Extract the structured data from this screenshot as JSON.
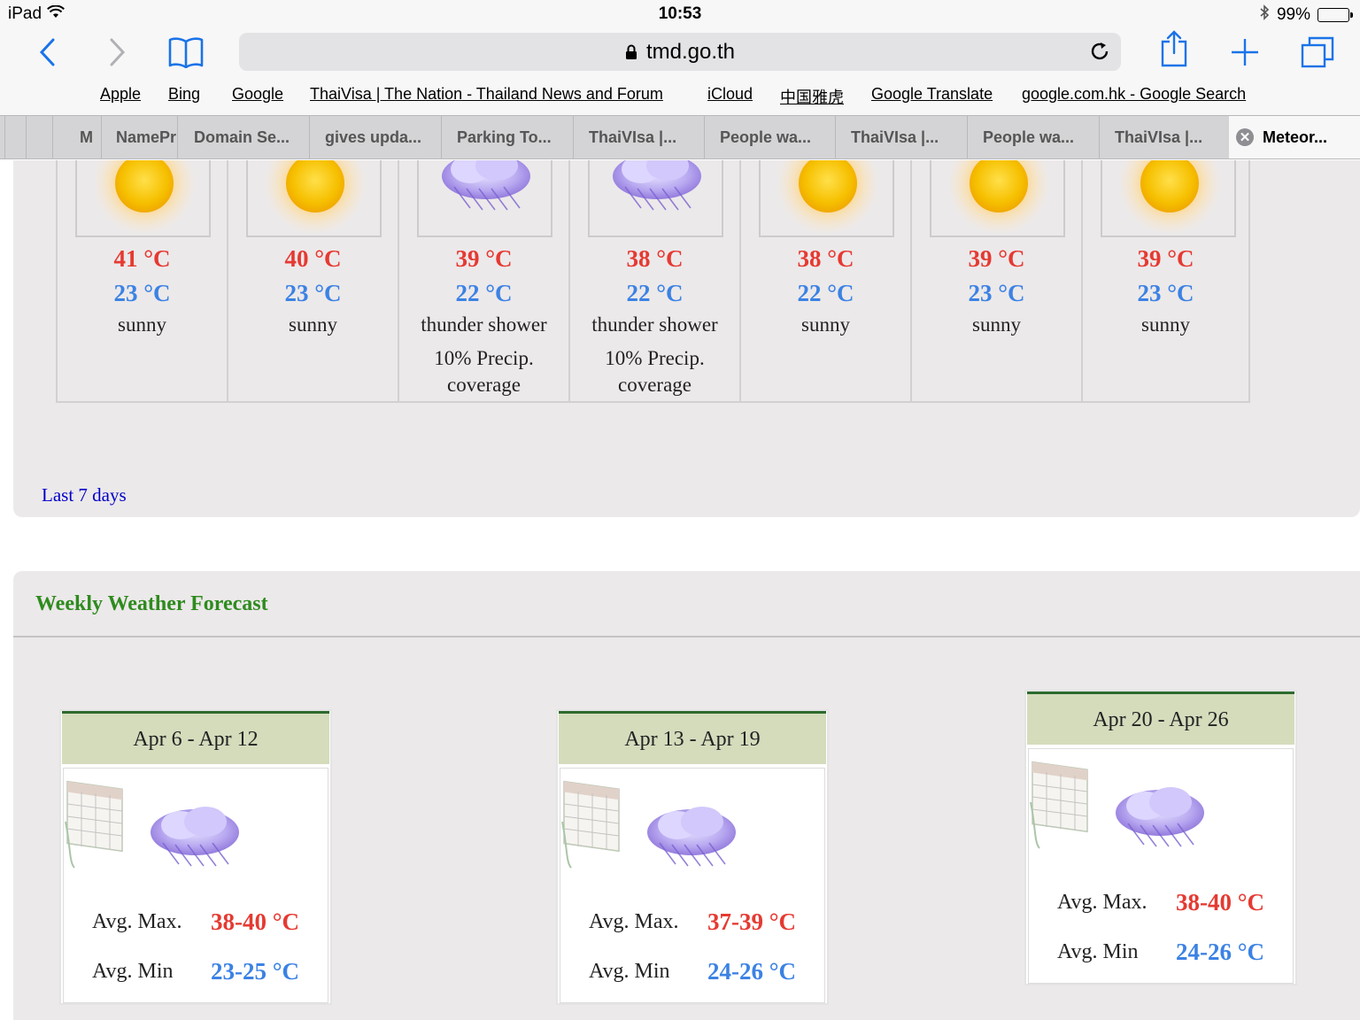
{
  "status_bar": {
    "device": "iPad",
    "time": "10:53",
    "battery": "99%"
  },
  "browser": {
    "url": "tmd.go.th",
    "favorites": [
      "Apple",
      "Bing",
      "Google",
      "ThaiVisa | The Nation - Thailand News and Forum",
      "iCloud",
      "中国雅虎",
      "Google Translate",
      "google.com.hk - Google Search"
    ],
    "tabs": [
      {
        "label": "M"
      },
      {
        "label": "NamePr"
      },
      {
        "label": "Domain Se..."
      },
      {
        "label": "gives upda..."
      },
      {
        "label": "Parking To..."
      },
      {
        "label": "ThaiVIsa |..."
      },
      {
        "label": "People wa..."
      },
      {
        "label": "ThaiVIsa |..."
      },
      {
        "label": "People wa..."
      },
      {
        "label": "ThaiVIsa |..."
      },
      {
        "label": "Meteor..."
      }
    ]
  },
  "daily": [
    {
      "icon": "sun-icon",
      "max": "41 °C",
      "min": "23 °C",
      "condition": "sunny",
      "precip": ""
    },
    {
      "icon": "sun-icon",
      "max": "40 °C",
      "min": "23 °C",
      "condition": "sunny",
      "precip": ""
    },
    {
      "icon": "storm-cloud-icon",
      "max": "39 °C",
      "min": "22 °C",
      "condition": "thunder shower",
      "precip": "10% Precip. coverage"
    },
    {
      "icon": "storm-cloud-icon",
      "max": "38 °C",
      "min": "22 °C",
      "condition": "thunder shower",
      "precip": "10% Precip. coverage"
    },
    {
      "icon": "sun-icon",
      "max": "38 °C",
      "min": "22 °C",
      "condition": "sunny",
      "precip": ""
    },
    {
      "icon": "sun-icon",
      "max": "39 °C",
      "min": "23 °C",
      "condition": "sunny",
      "precip": ""
    },
    {
      "icon": "sun-icon",
      "max": "39 °C",
      "min": "23 °C",
      "condition": "sunny",
      "precip": ""
    }
  ],
  "last7_link": "Last 7 days",
  "weekly": {
    "title": "Weekly Weather Forecast",
    "max_label": "Avg. Max.",
    "min_label": "Avg. Min",
    "weeks": [
      {
        "range": "Apr 6 - Apr 12",
        "max": "38-40 °C",
        "min": "23-25 °C"
      },
      {
        "range": "Apr 13 - Apr 19",
        "max": "37-39 °C",
        "min": "24-26 °C"
      },
      {
        "range": "Apr 20 - Apr 26",
        "max": "38-40 °C",
        "min": "24-26 °C"
      }
    ]
  },
  "colors": {
    "max_temp": "#e53a32",
    "min_temp": "#3b82e4",
    "weekly_title": "#2e8b1e",
    "link": "#0000c8",
    "system_blue": "#1a73e8"
  }
}
